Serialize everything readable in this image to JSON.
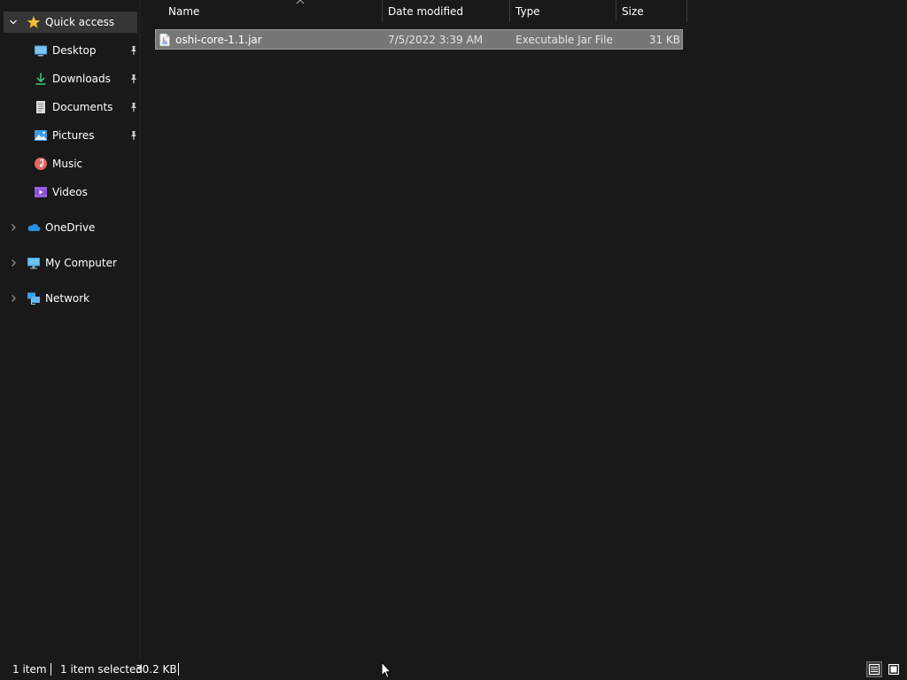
{
  "nav": {
    "quick_access": "Quick access",
    "items": [
      {
        "label": "Desktop",
        "icon": "desktop-icon",
        "pinned": true
      },
      {
        "label": "Downloads",
        "icon": "downloads-icon",
        "pinned": true
      },
      {
        "label": "Documents",
        "icon": "documents-icon",
        "pinned": true
      },
      {
        "label": "Pictures",
        "icon": "pictures-icon",
        "pinned": true
      },
      {
        "label": "Music",
        "icon": "music-icon",
        "pinned": false
      },
      {
        "label": "Videos",
        "icon": "videos-icon",
        "pinned": false
      }
    ],
    "roots": [
      {
        "label": "OneDrive",
        "icon": "onedrive-icon"
      },
      {
        "label": "My Computer",
        "icon": "computer-icon"
      },
      {
        "label": "Network",
        "icon": "network-icon"
      }
    ]
  },
  "columns": {
    "name": "Name",
    "date": "Date modified",
    "type": "Type",
    "size": "Size"
  },
  "files": [
    {
      "name": "oshi-core-1.1.jar",
      "date": "7/5/2022 3:39 AM",
      "type": "Executable Jar File",
      "size": "31 KB",
      "selected": true,
      "icon": "jar-file-icon"
    }
  ],
  "status": {
    "item_count": "1 item",
    "selection": "1 item selected",
    "selection_size": "30.2 KB"
  },
  "colors": {
    "background": "#191919",
    "selection": "#777777",
    "nav_selected": "#363636",
    "star": "#f2c133"
  }
}
